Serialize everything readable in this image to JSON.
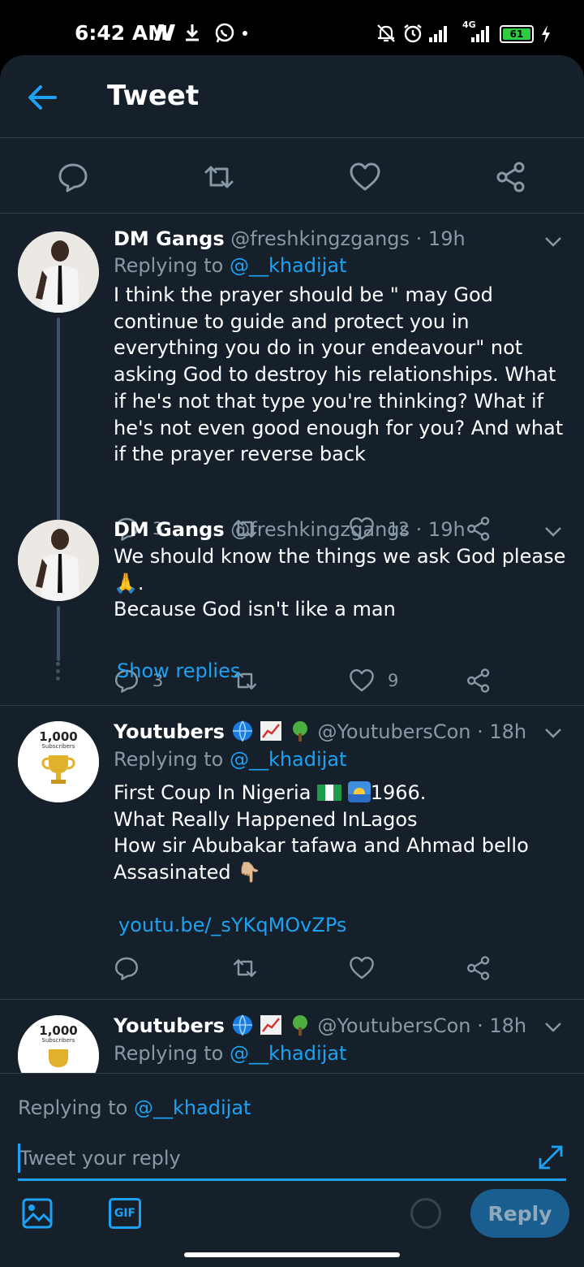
{
  "status_bar": {
    "time": "6:42 AM",
    "network": "4G",
    "battery": "61",
    "icons": [
      "n-notification-icon",
      "download-icon",
      "whatsapp-icon",
      "dot-icon",
      "mute-icon",
      "alarm-icon",
      "signal-icon",
      "signal-4g-icon",
      "battery-icon",
      "charging-icon"
    ]
  },
  "header": {
    "title": "Tweet",
    "back_icon": "arrow-left-icon"
  },
  "action_bar": [
    "reply-icon",
    "retweet-icon",
    "like-icon",
    "share-icon"
  ],
  "tweets": [
    {
      "name": "DM Gangs",
      "handle": "@freshkingzgangs",
      "time": "· 19h",
      "replying_label": "Replying to ",
      "replying_to": "@__khadijat",
      "text": "I think the prayer should be \" may God continue to guide and protect you in everything you do in your endeavour\" not asking God to destroy his relationships. What if he's not that type you're thinking? What if he's not even good enough for you? And what if the prayer reverse back",
      "replies": "3",
      "retweets": "",
      "likes": "12"
    },
    {
      "name": "DM Gangs",
      "handle": "@freshkingzgangs",
      "time": "· 19h",
      "text_line1": "We should know the things we ask God please🙏.",
      "text_line2": "Because God isn't like a man",
      "replies": "3",
      "retweets": "",
      "likes": "9",
      "show_replies": "Show replies"
    },
    {
      "name": "Youtubers",
      "name_emojis": [
        "globe-icon",
        "chart-icon",
        "tree-icon"
      ],
      "handle": "@YoutubersCon",
      "time": "· 18h",
      "replying_label": "Replying to ",
      "replying_to": "@__khadijat",
      "line1_text": "First Coup In Nigeria",
      "line1_year": "1966.",
      "line2": "What Really Happened InLagos",
      "line3": "How sir Abubakar tafawa and Ahmad bello",
      "line4": "Assasinated 👇🏼",
      "link": "youtu.be/_sYKqMOvZPs",
      "avatar_text": "1,000",
      "avatar_subtext": "Subscribers"
    },
    {
      "name": "Youtubers",
      "handle": "@YoutubersCon",
      "time": "· 18h",
      "replying_label": "Replying to ",
      "replying_to": "@__khadijat",
      "avatar_text": "1,000",
      "avatar_subtext": "Subscribers"
    }
  ],
  "composer": {
    "replying_label": "Replying to ",
    "replying_to": "@__khadijat",
    "placeholder": "Tweet your reply",
    "gif_label": "GIF",
    "reply_button": "Reply"
  },
  "colors": {
    "background": "#15202b",
    "accent": "#1da1f2",
    "muted": "#8899a6",
    "divider": "#2f3d4b"
  }
}
